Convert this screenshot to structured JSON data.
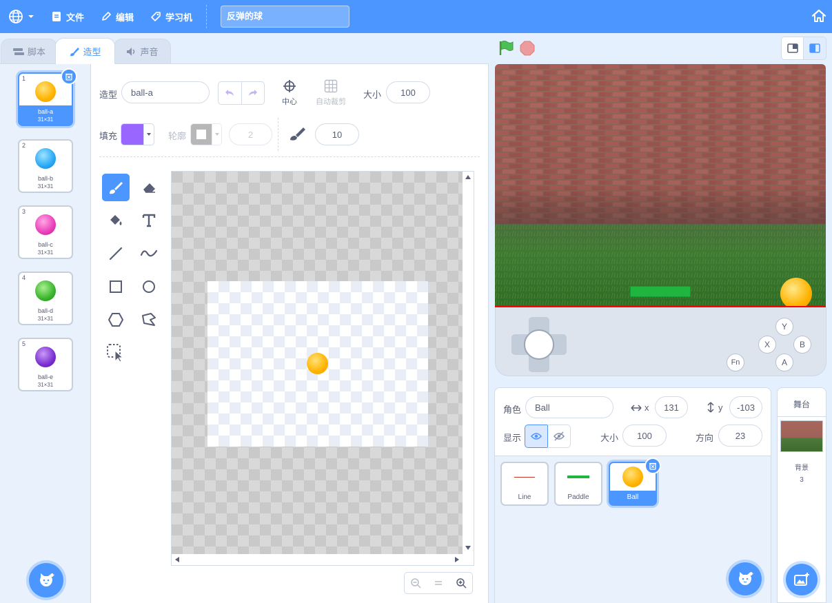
{
  "menubar": {
    "file_label": "文件",
    "edit_label": "编辑",
    "learn_label": "学习机",
    "project_title": "反弹的球"
  },
  "tabs": [
    {
      "label": "脚本",
      "icon": "code-icon"
    },
    {
      "label": "造型",
      "icon": "brush-icon"
    },
    {
      "label": "声音",
      "icon": "speaker-icon"
    }
  ],
  "costumes": [
    {
      "num": "1",
      "name": "ball-a",
      "size": "31×31",
      "color": "#ffb300"
    },
    {
      "num": "2",
      "name": "ball-b",
      "size": "31×31",
      "color": "#29a8f5"
    },
    {
      "num": "3",
      "name": "ball-c",
      "size": "31×31",
      "color": "#e93fb8"
    },
    {
      "num": "4",
      "name": "ball-d",
      "size": "31×31",
      "color": "#3ab52e"
    },
    {
      "num": "5",
      "name": "ball-e",
      "size": "31×31",
      "color": "#7b2fd2"
    }
  ],
  "paint": {
    "costume_label": "造型",
    "costume_name": "ball-a",
    "center_label": "中心",
    "autocrop_label": "自动裁剪",
    "size_label": "大小",
    "size_value": "100",
    "fill_label": "填充",
    "fill_color": "#9966ff",
    "outline_label": "轮廓",
    "outline_width": "2",
    "brush_size": "10"
  },
  "sprite": {
    "name_label": "角色",
    "name": "Ball",
    "x_label": "x",
    "x": "131",
    "y_label": "y",
    "y": "-103",
    "show_label": "显示",
    "size_label": "大小",
    "size": "100",
    "direction_label": "方向",
    "direction": "23"
  },
  "sprites": [
    {
      "name": "Line"
    },
    {
      "name": "Paddle"
    },
    {
      "name": "Ball"
    }
  ],
  "stage_panel": {
    "title": "舞台",
    "backdrop_label": "背景",
    "backdrop_count": "3"
  },
  "controller": {
    "y": "Y",
    "x": "X",
    "b": "B",
    "a": "A",
    "fn": "Fn"
  },
  "colors": {
    "accent": "#4c97ff",
    "paddle": "#1fb53f",
    "line": "#ff0000"
  }
}
